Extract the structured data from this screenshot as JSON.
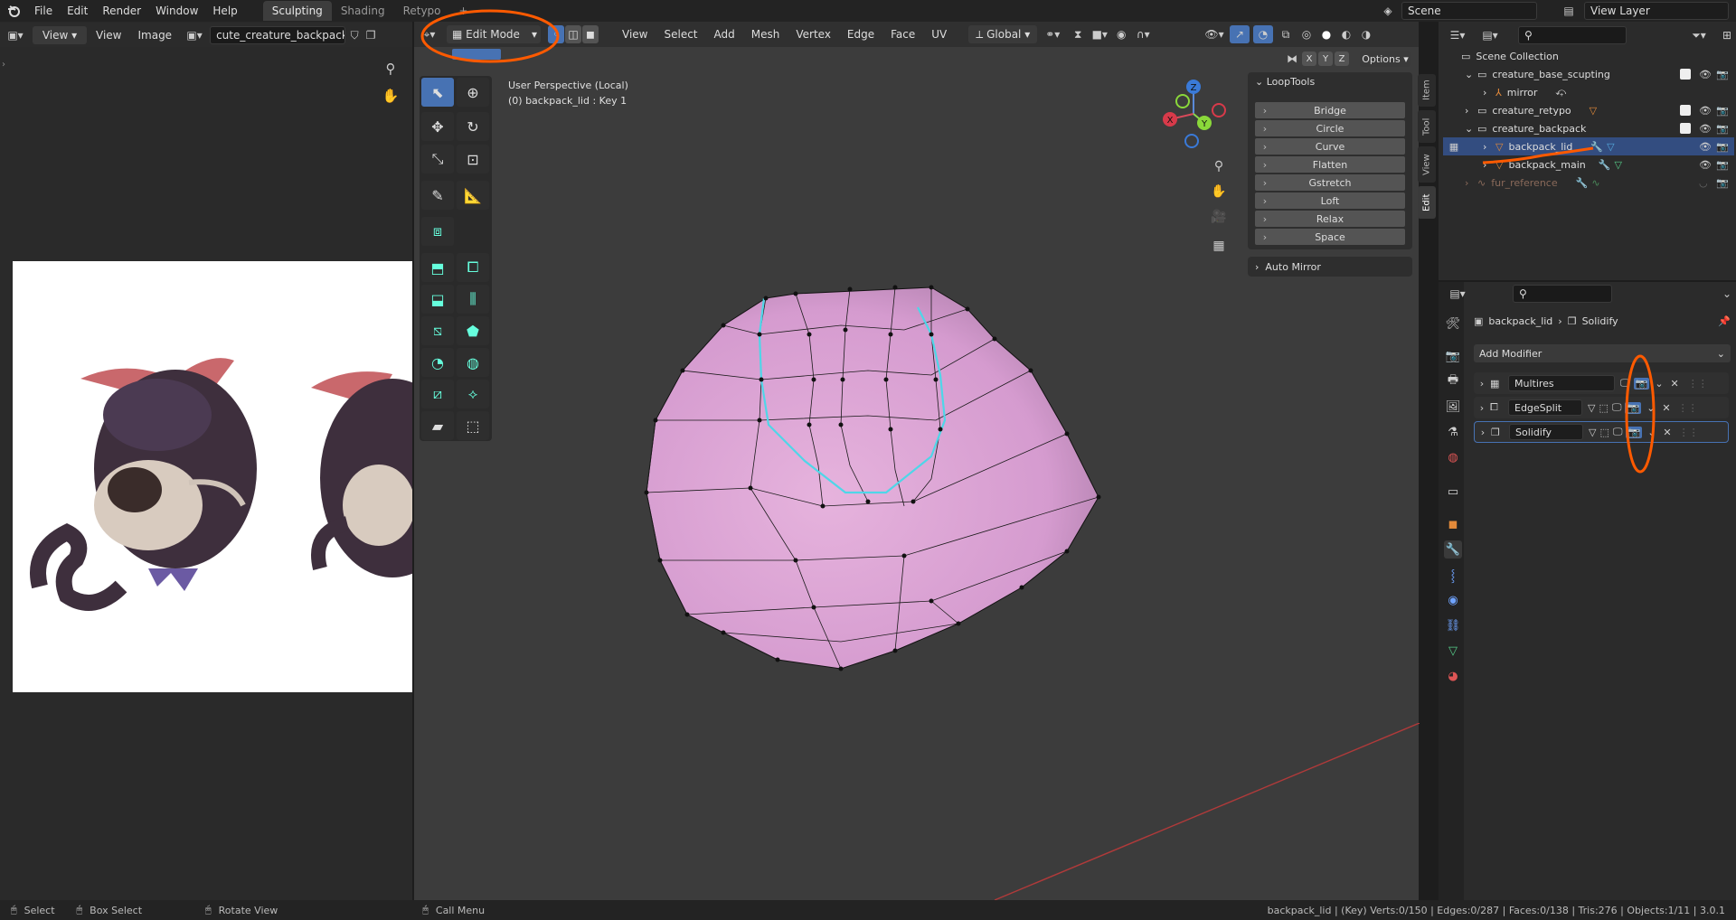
{
  "menu": {
    "file": "File",
    "edit": "Edit",
    "render": "Render",
    "window": "Window",
    "help": "Help"
  },
  "workspaces": [
    "Sculpting",
    "Shading",
    "Retypo"
  ],
  "scene": {
    "name": "Scene",
    "view_layer": "View Layer"
  },
  "image_editor": {
    "view_label": "View",
    "view_menu": "View",
    "image_menu": "Image",
    "filename": "cute_creature_backpack.jpg"
  },
  "viewport": {
    "mode": "Edit Mode",
    "menus": [
      "View",
      "Select",
      "Add",
      "Mesh",
      "Vertex",
      "Edge",
      "Face",
      "UV"
    ],
    "orientation": "Global",
    "options": "Options",
    "axes": [
      "X",
      "Y",
      "Z"
    ],
    "perspective": "User Perspective (Local)",
    "object_info": "(0) backpack_lid : Key 1",
    "gizmo": {
      "x": "X",
      "y": "Y",
      "z": "Z"
    }
  },
  "looptools": {
    "title": "LoopTools",
    "items": [
      "Bridge",
      "Circle",
      "Curve",
      "Flatten",
      "Gstretch",
      "Loft",
      "Relax",
      "Space"
    ],
    "auto_mirror": "Auto Mirror"
  },
  "side_tabs": [
    "Item",
    "Tool",
    "View",
    "Edit"
  ],
  "outliner": {
    "root": "Scene Collection",
    "rows": [
      {
        "label": "creature_base_scupting",
        "indent": 1,
        "type": "collection"
      },
      {
        "label": "mirror",
        "indent": 2,
        "type": "empty"
      },
      {
        "label": "creature_retypo",
        "indent": 1,
        "type": "collection"
      },
      {
        "label": "creature_backpack",
        "indent": 1,
        "type": "collection"
      },
      {
        "label": "backpack_lid",
        "indent": 2,
        "type": "mesh",
        "selected": true
      },
      {
        "label": "backpack_main",
        "indent": 2,
        "type": "mesh"
      },
      {
        "label": "fur_reference",
        "indent": 1,
        "type": "curves",
        "dim": true
      }
    ]
  },
  "properties": {
    "breadcrumb_object": "backpack_lid",
    "breadcrumb_modifier": "Solidify",
    "add_modifier": "Add Modifier",
    "modifiers": [
      "Multires",
      "EdgeSplit",
      "Solidify"
    ]
  },
  "status_bar": {
    "select": "Select",
    "box_select": "Box Select",
    "rotate": "Rotate View",
    "call_menu": "Call Menu",
    "stats": "backpack_lid | (Key) Verts:0/150 | Edges:0/287 | Faces:0/138 | Tris:276 | Objects:1/11 | 3.0.1"
  },
  "colors": {
    "accent": "#4772b3",
    "annotation": "#ff5a00",
    "mesh": "#d59bcf",
    "seam": "#4fd6e8"
  }
}
